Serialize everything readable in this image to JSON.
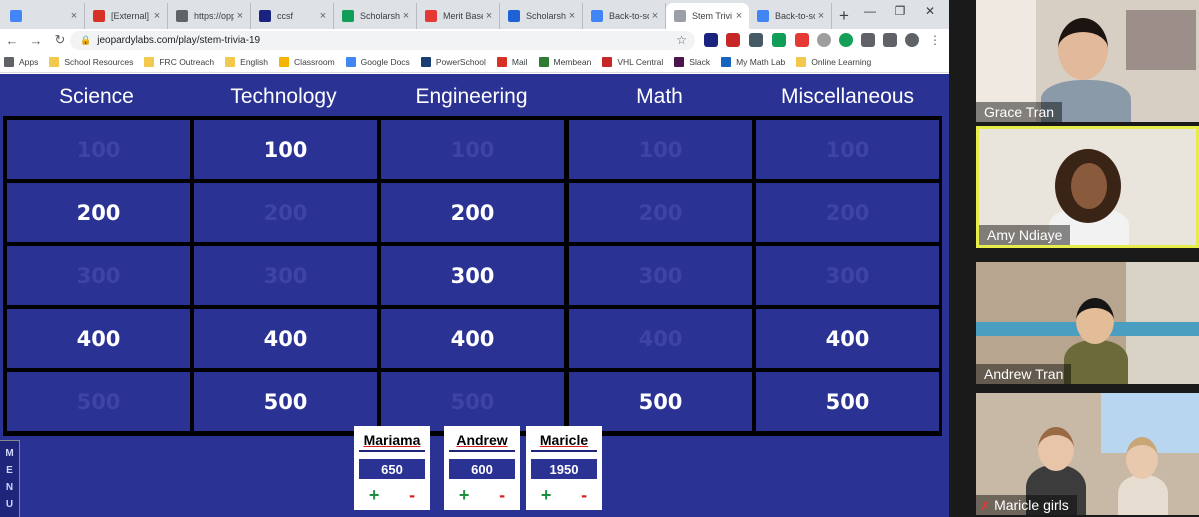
{
  "browser": {
    "tabs": [
      {
        "label": "",
        "icon": "docs-icon",
        "color": "#4285f4",
        "active": false
      },
      {
        "label": "[External] ",
        "icon": "gmail-icon",
        "color": "#d93025",
        "active": false
      },
      {
        "label": "https://opp",
        "icon": "shield-icon",
        "color": "#5f6368",
        "active": false
      },
      {
        "label": "ccsf",
        "icon": "wh-icon",
        "color": "#1a237e",
        "active": false
      },
      {
        "label": "Scholarshi",
        "icon": "sheets-icon",
        "color": "#0f9d58",
        "active": false
      },
      {
        "label": "Merit Base",
        "icon": "go-icon",
        "color": "#e53935",
        "active": false
      },
      {
        "label": "Scholarshi",
        "icon": "scholarship-icon",
        "color": "#1e63d6",
        "active": false
      },
      {
        "label": "Back-to-sc",
        "icon": "docs-icon",
        "color": "#4285f4",
        "active": false
      },
      {
        "label": "Stem Trivi",
        "icon": "jeopardy-icon",
        "color": "#9aa0a6",
        "active": true
      },
      {
        "label": "Back-to-sc",
        "icon": "docs-icon",
        "color": "#4285f4",
        "active": false
      }
    ],
    "url": "jeopardylabs.com/play/stem-trivia-19",
    "bookmarks": [
      {
        "label": "Apps",
        "color": "#5f6368"
      },
      {
        "label": "School Resources",
        "color": "#f2c94c"
      },
      {
        "label": "FRC Outreach",
        "color": "#f2c94c"
      },
      {
        "label": "English",
        "color": "#f2c94c"
      },
      {
        "label": "Classroom",
        "color": "#f4b400"
      },
      {
        "label": "Google Docs",
        "color": "#4285f4"
      },
      {
        "label": "PowerSchool",
        "color": "#1a3e72"
      },
      {
        "label": "Mail",
        "color": "#d93025"
      },
      {
        "label": "Membean",
        "color": "#2e7d32"
      },
      {
        "label": "VHL Central",
        "color": "#c62828"
      },
      {
        "label": "Slack",
        "color": "#4a154b"
      },
      {
        "label": "My Math Lab",
        "color": "#1565c0"
      },
      {
        "label": "Online Learning",
        "color": "#f2c94c"
      }
    ]
  },
  "game": {
    "categories": [
      "Science",
      "Technology",
      "Engineering",
      "Math",
      "Miscellaneous"
    ],
    "rows": [
      [
        {
          "v": "100",
          "used": true
        },
        {
          "v": "100",
          "used": false
        },
        {
          "v": "100",
          "used": true
        },
        {
          "v": "100",
          "used": true
        },
        {
          "v": "100",
          "used": true
        }
      ],
      [
        {
          "v": "200",
          "used": false
        },
        {
          "v": "200",
          "used": true
        },
        {
          "v": "200",
          "used": false
        },
        {
          "v": "200",
          "used": true
        },
        {
          "v": "200",
          "used": true
        }
      ],
      [
        {
          "v": "300",
          "used": true
        },
        {
          "v": "300",
          "used": true
        },
        {
          "v": "300",
          "used": false
        },
        {
          "v": "300",
          "used": true
        },
        {
          "v": "300",
          "used": true
        }
      ],
      [
        {
          "v": "400",
          "used": false
        },
        {
          "v": "400",
          "used": false
        },
        {
          "v": "400",
          "used": false
        },
        {
          "v": "400",
          "used": true
        },
        {
          "v": "400",
          "used": false
        }
      ],
      [
        {
          "v": "500",
          "used": true
        },
        {
          "v": "500",
          "used": false
        },
        {
          "v": "500",
          "used": true
        },
        {
          "v": "500",
          "used": false
        },
        {
          "v": "500",
          "used": false
        }
      ]
    ],
    "menu_label": "MENU",
    "teams": [
      {
        "name": "Mariama",
        "score": "650",
        "plus": "+",
        "minus": "-"
      },
      {
        "name": "Andrew",
        "score": "600",
        "plus": "+",
        "minus": "-"
      },
      {
        "name": "Maricle",
        "score": "1950",
        "plus": "+",
        "minus": "-"
      }
    ],
    "colors": {
      "board_blue": "#2a3294",
      "used_text": "#3d44a3",
      "plus": "#1e8f3e",
      "minus": "#d52020"
    }
  },
  "participants": [
    {
      "name": "Grace Tran",
      "speaking": false
    },
    {
      "name": "Amy Ndiaye",
      "speaking": true
    },
    {
      "name": "Andrew Tran",
      "speaking": false
    },
    {
      "name": "Maricle girls",
      "speaking": false,
      "muted": true
    }
  ]
}
